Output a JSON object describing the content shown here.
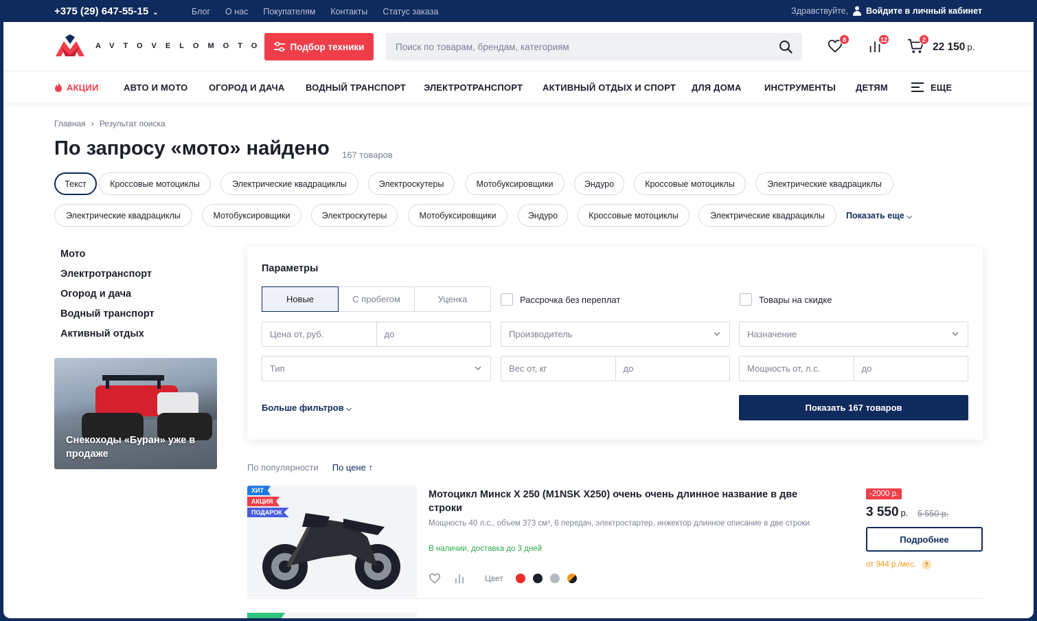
{
  "topbar": {
    "phone": "+375 (29) 647-55-15",
    "links": [
      "Блог",
      "О нас",
      "Покупателям",
      "Контакты",
      "Статус заказа"
    ],
    "greeting": "Здравствуйте,",
    "login": "Войдите в личный кабинет"
  },
  "header": {
    "logo_text": "AVTOVELOMOTO",
    "pick_button": "Подбор техники",
    "search_placeholder": "Поиск по товарам, брендам, категориям",
    "favorites_count": "8",
    "compare_count": "12",
    "cart_count": "2",
    "cart_sum": "22 150",
    "cart_currency": "р."
  },
  "nav": {
    "promo": "АКЦИИ",
    "items": [
      "АВТО И МОТО",
      "ОГОРОД И ДАЧА",
      "ВОДНЫЙ ТРАНСПОРТ",
      "ЭЛЕКТРОТРАНСПОРТ",
      "АКТИВНЫЙ ОТДЫХ И СПОРТ",
      "ДЛЯ ДОМА",
      "ИНСТРУМЕНТЫ",
      "ДЕТЯМ"
    ],
    "more": "ЕЩЕ"
  },
  "breadcrumbs": [
    "Главная",
    "Результат поиска"
  ],
  "page": {
    "title": "По запросу «мото» найдено",
    "count": "167 товаров"
  },
  "chips_row1": [
    "Текст",
    "Кроссовые мотоциклы",
    "Электрические квадрациклы",
    "Электроскутеры",
    "Мотобуксировщики",
    "Эндуро",
    "Кроссовые мотоциклы",
    "Электрические квадрациклы"
  ],
  "chips_row2": [
    "Электрические квадрациклы",
    "Мотобуксировщики",
    "Электроскутеры",
    "Мотобуксировщики",
    "Эндуро",
    "Кроссовые мотоциклы",
    "Электрические квадрациклы"
  ],
  "show_more": "Показать еще",
  "categories": [
    "Мото",
    "Электротранспорт",
    "Огород и дача",
    "Водный транспорт",
    "Активный отдых"
  ],
  "promo_card": "Снекоходы «Буран» уже в продаже",
  "filters": {
    "title": "Параметры",
    "condition": [
      "Новые",
      "С пробегом",
      "Уценка"
    ],
    "installment": "Рассрочка без переплат",
    "discount": "Товары на скидке",
    "price_from": "Цена от, руб.",
    "price_to": "до",
    "manufacturer": "Производитель",
    "purpose": "Назначение",
    "type": "Тип",
    "weight_from": "Вес от, кг",
    "weight_to": "до",
    "power_from": "Мощность от, л.с.",
    "power_to": "до",
    "more_filters": "Больше фильтров",
    "show_button": "Показать 167 товаров"
  },
  "sort": {
    "popularity": "По популярности",
    "price": "По цене"
  },
  "product": {
    "tags": [
      {
        "label": "ХИТ",
        "color": "#1e7be0"
      },
      {
        "label": "АКЦИЯ",
        "color": "#ef3e4a"
      },
      {
        "label": "ПОДАРОК",
        "color": "#4a5be0"
      }
    ],
    "name": "Мотоцикл Минск X 250 (M1NSK X250) очень очень длинное название в две строки",
    "description": "Мощность 40 л.с., объем 373 см³, 6 передач, электростартер, инжектор длинное описание в две строки",
    "stock": "В наличии, доставка до 3 дней",
    "color_label": "Цвет",
    "colors": [
      "#ef2b2b",
      "#1b1f29",
      "#b5b9c1",
      "orange-black"
    ],
    "discount": "-2000 р.",
    "price": "3 550",
    "currency": "р.",
    "old_price": "5 550 р.",
    "details_button": "Подробнее",
    "credit": "от 944 р./мес.",
    "credit_help": "?"
  }
}
